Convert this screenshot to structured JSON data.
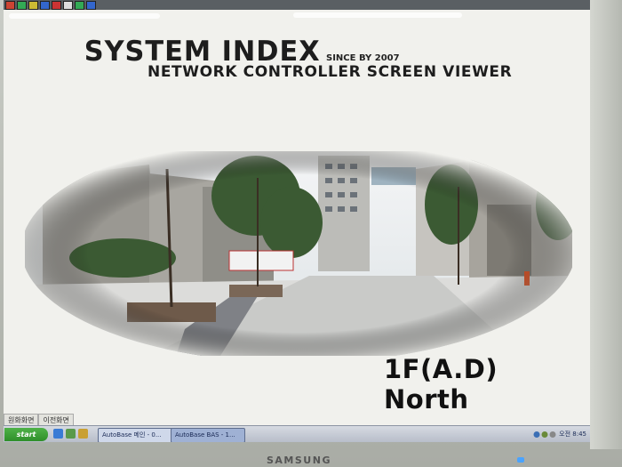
{
  "screen": {
    "title": "SYSTEM INDEX",
    "since": "SINCE BY 2007",
    "subtitle": "NETWORK CONTROLLER SCREEN VIEWER",
    "location": "1F(A.D) North"
  },
  "bottom_tabs": [
    "원화화면",
    "이전화면"
  ],
  "taskbar": {
    "start_label": "start",
    "tasks": [
      "AutoBase 메인 - 0...",
      "AutoBase BAS - 1..."
    ],
    "clock": "오전 8:45"
  },
  "monitor": {
    "brand": "SAMSUNG"
  },
  "colors": {
    "screen_bg": "#f1f1ed",
    "title": "#1d1d1d",
    "taskbar": "#c8cdd7",
    "start": "#3a9e33"
  }
}
